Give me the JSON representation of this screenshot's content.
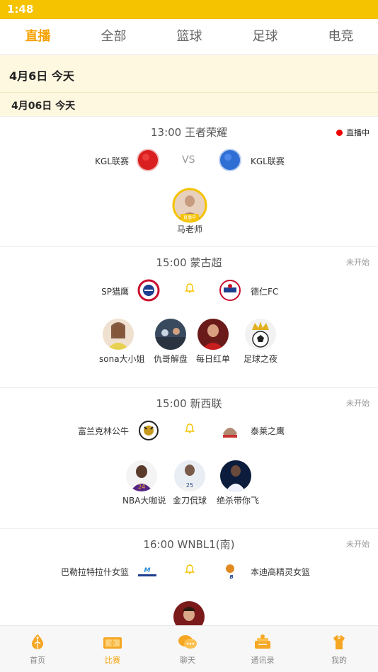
{
  "status_bar": {
    "time": "1:48"
  },
  "tabs": [
    {
      "label": "直播",
      "active": true
    },
    {
      "label": "全部",
      "active": false
    },
    {
      "label": "篮球",
      "active": false
    },
    {
      "label": "足球",
      "active": false
    },
    {
      "label": "电竞",
      "active": false
    }
  ],
  "date_banner": "4月6日  今天",
  "date_sub": "4月06日   今天",
  "matches": [
    {
      "title": "13:00  王者荣耀",
      "status": "直播中",
      "home": "KGL联赛",
      "away": "KGL联赛",
      "vs": "VS",
      "live_badge": "直播中",
      "anchors": [
        {
          "name": "马老师"
        }
      ]
    },
    {
      "title": "15:00  蒙古超",
      "status": "未开始",
      "home": "SP猎鹰",
      "away": "德仁FC",
      "anchors": [
        {
          "name": "sona大小姐"
        },
        {
          "name": "仇哥解盘"
        },
        {
          "name": "每日红单"
        },
        {
          "name": "足球之夜"
        }
      ]
    },
    {
      "title": "15:00  新西联",
      "status": "未开始",
      "home": "富兰克林公牛",
      "away": "泰莱之鹰",
      "anchors": [
        {
          "name": "NBA大咖说"
        },
        {
          "name": "金刀侃球"
        },
        {
          "name": "绝杀带你飞"
        }
      ]
    },
    {
      "title": "16:00  WNBL1(南)",
      "status": "未开始",
      "home": "巴勒拉特拉什女篮",
      "away": "本迪高精灵女篮",
      "anchors": []
    }
  ],
  "bottom_nav": [
    {
      "label": "首页",
      "icon": "home-icon",
      "active": false
    },
    {
      "label": "比赛",
      "icon": "match-icon",
      "active": true
    },
    {
      "label": "聊天",
      "icon": "chat-icon",
      "active": false
    },
    {
      "label": "通讯录",
      "icon": "contacts-icon",
      "active": false
    },
    {
      "label": "我的",
      "icon": "profile-icon",
      "active": false
    }
  ],
  "colors": {
    "brand": "#f5c300",
    "accent": "#f5a100",
    "live": "#ee0000",
    "banner_bg": "#fff8e1"
  }
}
